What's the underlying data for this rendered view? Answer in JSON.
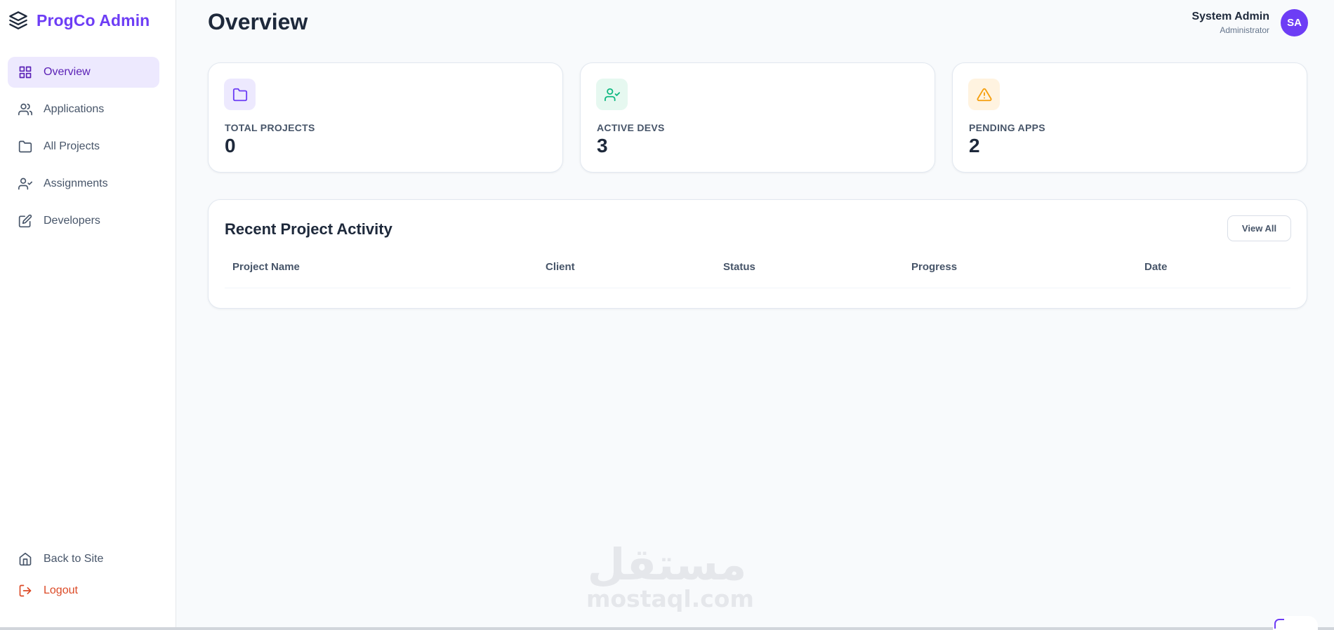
{
  "brand": {
    "name": "ProgCo Admin",
    "icon": "layers-icon",
    "color": "#6d3df5"
  },
  "sidebar": {
    "items": [
      {
        "label": "Overview",
        "icon": "grid-icon",
        "active": true
      },
      {
        "label": "Applications",
        "icon": "users-icon"
      },
      {
        "label": "All Projects",
        "icon": "folder-icon"
      },
      {
        "label": "Assignments",
        "icon": "user-check-icon"
      },
      {
        "label": "Developers",
        "icon": "edit-icon"
      }
    ],
    "bottom": [
      {
        "label": "Back to Site",
        "icon": "home-icon"
      },
      {
        "label": "Logout",
        "icon": "logout-icon",
        "color": "#dc4a26"
      }
    ]
  },
  "header": {
    "title": "Overview",
    "user_name": "System Admin",
    "user_role": "Administrator",
    "avatar_initials": "SA"
  },
  "stats": [
    {
      "label": "TOTAL PROJECTS",
      "value": "0",
      "icon": "folder-icon",
      "color": "#6d3df5",
      "bg": "#ede9fe"
    },
    {
      "label": "ACTIVE DEVS",
      "value": "3",
      "icon": "user-check-icon",
      "color": "#10b981",
      "bg": "#e6f8f0"
    },
    {
      "label": "PENDING APPS",
      "value": "2",
      "icon": "alert-triangle-icon",
      "color": "#f59e0b",
      "bg": "#fff3e0"
    }
  ],
  "activity": {
    "title": "Recent Project Activity",
    "view_all_label": "View All",
    "columns": [
      "Project Name",
      "Client",
      "Status",
      "Progress",
      "Date"
    ]
  },
  "watermark": {
    "arabic": "مستقل",
    "latin": "mostaql.com"
  }
}
